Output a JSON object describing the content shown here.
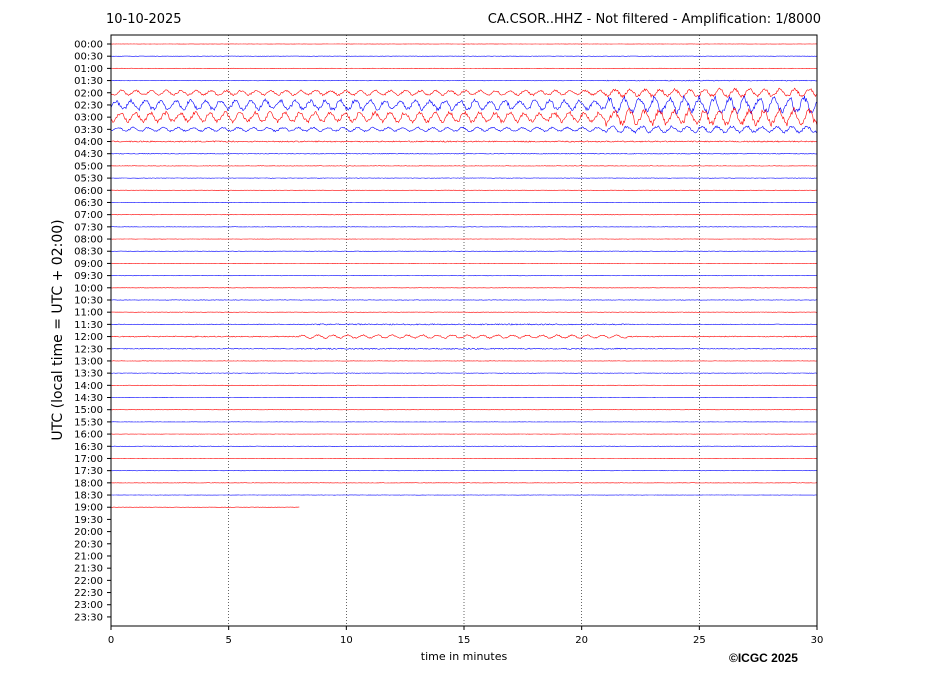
{
  "header": {
    "date": "10-10-2025",
    "station_title": "CA.CSOR..HHZ - Not filtered - Amplification: 1/8000"
  },
  "credit": "©ICGC 2025",
  "chart_data": {
    "type": "line",
    "title": "CA.CSOR..HHZ - Not filtered - Amplification: 1/8000",
    "xlabel": "time in minutes",
    "ylabel": "UTC (local time = UTC + 02:00)",
    "xlim": [
      0,
      30
    ],
    "xticks": [
      "0",
      "5",
      "10",
      "15",
      "20",
      "25",
      "30"
    ],
    "grid": "vertical dotted at every 5 minutes",
    "series_colors": [
      "#ff0000",
      "#0000ff"
    ],
    "rows": [
      "00:00",
      "00:30",
      "01:00",
      "01:30",
      "02:00",
      "02:30",
      "03:00",
      "03:30",
      "04:00",
      "04:30",
      "05:00",
      "05:30",
      "06:00",
      "06:30",
      "07:00",
      "07:30",
      "08:00",
      "08:30",
      "09:00",
      "09:30",
      "10:00",
      "10:30",
      "11:00",
      "11:30",
      "12:00",
      "12:30",
      "13:00",
      "13:30",
      "14:00",
      "14:30",
      "15:00",
      "15:30",
      "16:00",
      "16:30",
      "17:00",
      "17:30",
      "18:00",
      "18:30",
      "19:00",
      "19:30",
      "20:00",
      "20:30",
      "21:00",
      "21:30",
      "22:00",
      "22:30",
      "23:00",
      "23:30"
    ],
    "relative_amplitude": [
      0.3,
      0.3,
      0.3,
      0.5,
      3,
      6,
      6,
      2.5,
      1.2,
      0.6,
      0.4,
      0.4,
      0.3,
      0.4,
      0.4,
      0.3,
      0.3,
      0.3,
      0.3,
      0.4,
      0.3,
      0.5,
      0.3,
      1.2,
      2,
      1.2,
      0.4,
      0.4,
      0.3,
      0.3,
      0.3,
      0.3,
      0.3,
      0.3,
      0.3,
      0.3,
      0.3,
      0.3,
      0.3,
      0,
      0,
      0,
      0,
      0,
      0,
      0,
      0,
      0
    ],
    "row_end_minutes": [
      30,
      30,
      30,
      30,
      30,
      30,
      30,
      30,
      30,
      30,
      30,
      30,
      30,
      30,
      30,
      30,
      30,
      30,
      30,
      30,
      30,
      30,
      30,
      30,
      30,
      30,
      30,
      30,
      30,
      30,
      30,
      30,
      30,
      30,
      30,
      30,
      30,
      30,
      8,
      0,
      0,
      0,
      0,
      0,
      0,
      0,
      0,
      0
    ]
  }
}
